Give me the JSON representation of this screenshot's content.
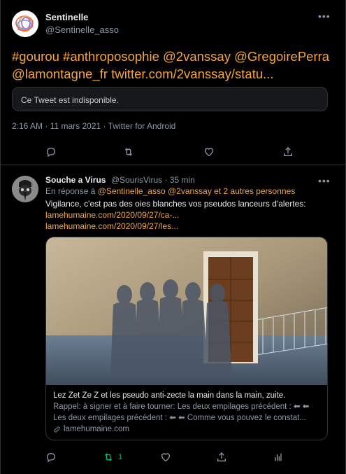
{
  "tweet1": {
    "author_name": "Sentinelle",
    "author_handle": "@Sentinelle_asso",
    "body_line1": "#gourou #anthroposophie @2vanssay @GregoirePerra",
    "body_line2": "@lamontagne_fr twitter.com/2vanssay/statu...",
    "unavailable_text": "Ce Tweet est indisponible.",
    "meta": "2:16 AM · 11 mars 2021 · Twitter for Android"
  },
  "tweet2": {
    "author_name": "Souche a Virus",
    "author_handle": "@SourisVirus",
    "separator": " · ",
    "time": "35 min",
    "reply_prefix": "En réponse à ",
    "reply_mentions": "@Sentinelle_asso @2vanssay  et 2 autres personnes",
    "text": "Vigilance, c'est pas des oies blanches vos pseudos lanceurs d'alertes:",
    "link1": "lamehumaine.com/2020/09/27/ca-...",
    "link2": "lamehumaine.com/2020/09/27/les...",
    "card": {
      "title": "Lez Zet Ze Z et les pseudo anti-zecte la main dans la main, zuite.",
      "desc_line1": "Rappel: à signer et à faire tourner: Les deux empilages précédent : ⬅ ⬅",
      "desc_line2": "Les deux empilages précédent : ⬅ ⬅ Comme vous pouvez le constat...",
      "domain": "lamehumaine.com"
    },
    "retweet_count": "1",
    "retweet_color": "#00ba7c"
  },
  "colors": {
    "accent": "#f7a53a",
    "muted": "#8b98a5",
    "background": "#000000",
    "border": "#2f3336"
  },
  "icons": {
    "reply": "reply-icon",
    "retweet": "retweet-icon",
    "like": "heart-icon",
    "share": "share-icon",
    "analytics": "analytics-icon",
    "more": "more-dots-icon",
    "link": "link-icon"
  }
}
